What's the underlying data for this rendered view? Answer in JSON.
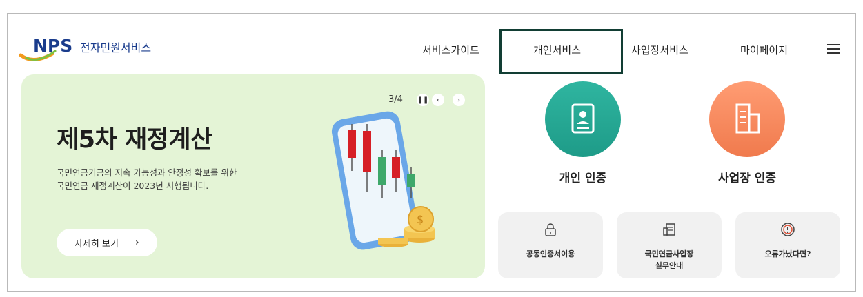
{
  "logo": {
    "brand": "NPS",
    "subtitle": "전자민원서비스"
  },
  "nav": {
    "items": [
      {
        "label": "서비스가이드"
      },
      {
        "label": "개인서비스",
        "highlighted": true
      },
      {
        "label": "사업장서비스"
      },
      {
        "label": "마이페이지"
      }
    ],
    "menu_icon": "hamburger-icon"
  },
  "banner": {
    "page_indicator": "3/4",
    "title": "제5차 재정계산",
    "desc_line1": "국민연금기금의 지속 가능성과 안정성 확보를 위한",
    "desc_line2": "국민연금 재정계산이 2023년 시행됩니다.",
    "detail_button": "자세히 보기",
    "background": "#e4f4d6"
  },
  "certs": {
    "personal": {
      "label": "개인 인증",
      "icon": "id-card-icon",
      "color": "#2fb5a0"
    },
    "business": {
      "label": "사업장 인증",
      "icon": "building-icon",
      "color": "#f07a4d"
    }
  },
  "tiles": [
    {
      "label": "공동인증서이용",
      "icon": "lock-icon"
    },
    {
      "label_line1": "국민연금사업장",
      "label_line2": "실무안내",
      "icon": "document-icon"
    },
    {
      "label": "오류가났다면?",
      "icon": "alert-icon"
    }
  ]
}
